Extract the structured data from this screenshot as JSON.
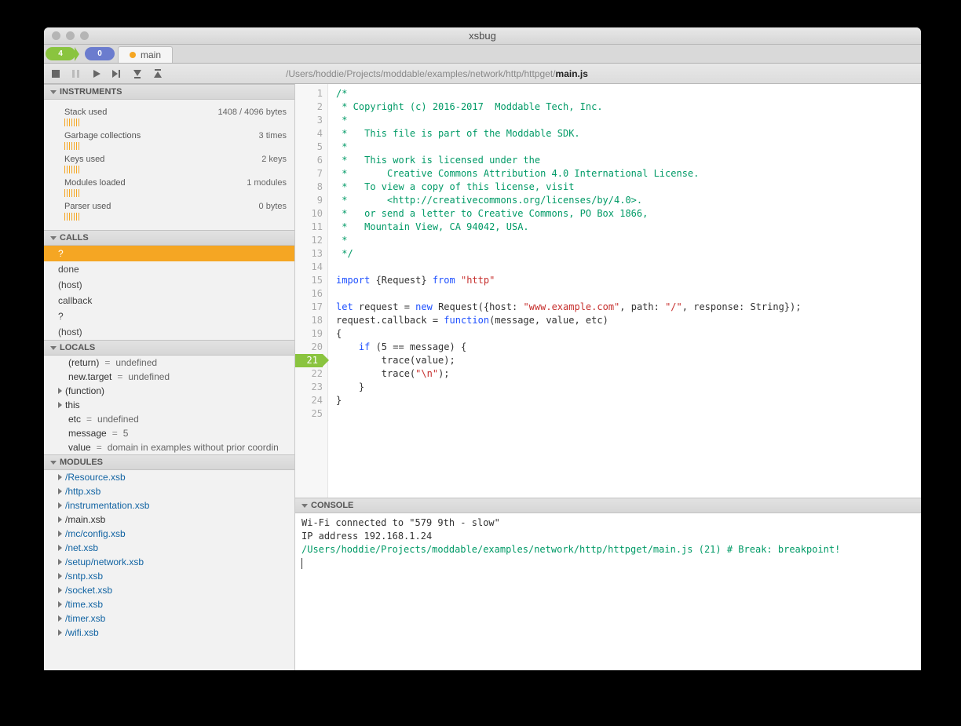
{
  "window": {
    "title": "xsbug"
  },
  "tabbar": {
    "green_badge": "4",
    "blue_badge": "0",
    "tabs": [
      {
        "label": "main"
      }
    ]
  },
  "path": {
    "dir": "/Users/hoddie/Projects/moddable/examples/network/http/httpget/",
    "file": "main.js"
  },
  "sections": {
    "instruments": "INSTRUMENTS",
    "calls": "CALLS",
    "locals": "LOCALS",
    "modules": "MODULES",
    "console": "CONSOLE"
  },
  "instruments": [
    {
      "label": "Stack used",
      "value": "1408 / 4096 bytes"
    },
    {
      "label": "Garbage collections",
      "value": "3 times"
    },
    {
      "label": "Keys used",
      "value": "2 keys"
    },
    {
      "label": "Modules loaded",
      "value": "1 modules"
    },
    {
      "label": "Parser used",
      "value": "0 bytes"
    }
  ],
  "calls": [
    {
      "label": "?",
      "selected": true
    },
    {
      "label": "done"
    },
    {
      "label": "(host)"
    },
    {
      "label": "callback"
    },
    {
      "label": "?"
    },
    {
      "label": "(host)"
    }
  ],
  "locals": [
    {
      "expand": false,
      "key": "(return)",
      "eq": true,
      "val": "undefined"
    },
    {
      "expand": false,
      "key": "new.target",
      "eq": true,
      "val": "undefined"
    },
    {
      "expand": true,
      "key": "(function)",
      "eq": false
    },
    {
      "expand": true,
      "key": "this",
      "eq": false
    },
    {
      "expand": false,
      "key": "etc",
      "eq": true,
      "val": "undefined"
    },
    {
      "expand": false,
      "key": "message",
      "eq": true,
      "val": "5"
    },
    {
      "expand": false,
      "key": "value",
      "eq": true,
      "val": "     domain in examples without prior coordin"
    }
  ],
  "modules": [
    {
      "name": "/Resource.xsb",
      "link": true
    },
    {
      "name": "/http.xsb",
      "link": true
    },
    {
      "name": "/instrumentation.xsb",
      "link": true
    },
    {
      "name": "/main.xsb",
      "link": false
    },
    {
      "name": "/mc/config.xsb",
      "link": true
    },
    {
      "name": "/net.xsb",
      "link": true
    },
    {
      "name": "/setup/network.xsb",
      "link": true
    },
    {
      "name": "/sntp.xsb",
      "link": true
    },
    {
      "name": "/socket.xsb",
      "link": true
    },
    {
      "name": "/time.xsb",
      "link": true
    },
    {
      "name": "/timer.xsb",
      "link": true
    },
    {
      "name": "/wifi.xsb",
      "link": true
    }
  ],
  "code": {
    "current_line": 21,
    "lines": [
      [
        [
          "cmt",
          "/*"
        ]
      ],
      [
        [
          "cmt",
          " * Copyright (c) 2016-2017  Moddable Tech, Inc."
        ]
      ],
      [
        [
          "cmt",
          " *"
        ]
      ],
      [
        [
          "cmt",
          " *   This file is part of the Moddable SDK."
        ]
      ],
      [
        [
          "cmt",
          " *   "
        ]
      ],
      [
        [
          "cmt",
          " *   This work is licensed under the"
        ]
      ],
      [
        [
          "cmt",
          " *       Creative Commons Attribution 4.0 International License."
        ]
      ],
      [
        [
          "cmt",
          " *   To view a copy of this license, visit"
        ]
      ],
      [
        [
          "cmt",
          " *       <http://creativecommons.org/licenses/by/4.0>."
        ]
      ],
      [
        [
          "cmt",
          " *   or send a letter to Creative Commons, PO Box 1866,"
        ]
      ],
      [
        [
          "cmt",
          " *   Mountain View, CA 94042, USA."
        ]
      ],
      [
        [
          "cmt",
          " *"
        ]
      ],
      [
        [
          "cmt",
          " */"
        ]
      ],
      [],
      [
        [
          "kw",
          "import"
        ],
        [
          "",
          " {Request} "
        ],
        [
          "kw",
          "from"
        ],
        [
          "",
          " "
        ],
        [
          "str",
          "\"http\""
        ]
      ],
      [],
      [
        [
          "kw",
          "let"
        ],
        [
          "",
          " request = "
        ],
        [
          "kw",
          "new"
        ],
        [
          "",
          " Request({host: "
        ],
        [
          "str",
          "\"www.example.com\""
        ],
        [
          "",
          ", path: "
        ],
        [
          "str",
          "\"/\""
        ],
        [
          "",
          ", response: String});"
        ]
      ],
      [
        [
          "",
          "request.callback = "
        ],
        [
          "kw",
          "function"
        ],
        [
          "",
          "(message, value, etc)"
        ]
      ],
      [
        [
          "",
          "{"
        ]
      ],
      [
        [
          "",
          "    "
        ],
        [
          "kw",
          "if"
        ],
        [
          "",
          " (5 == message) {"
        ]
      ],
      [
        [
          "",
          "        trace(value);"
        ]
      ],
      [
        [
          "",
          "        trace("
        ],
        [
          "str",
          "\"\\n\""
        ],
        [
          "",
          ");"
        ]
      ],
      [
        [
          "",
          "    }"
        ]
      ],
      [
        [
          "",
          "}"
        ]
      ],
      []
    ]
  },
  "console": {
    "lines": [
      {
        "cls": "",
        "text": "Wi-Fi connected to \"579 9th - slow\""
      },
      {
        "cls": "",
        "text": "IP address 192.168.1.24"
      },
      {
        "cls": "break",
        "text": "/Users/hoddie/Projects/moddable/examples/network/http/httpget/main.js (21) # Break: breakpoint!"
      }
    ]
  }
}
